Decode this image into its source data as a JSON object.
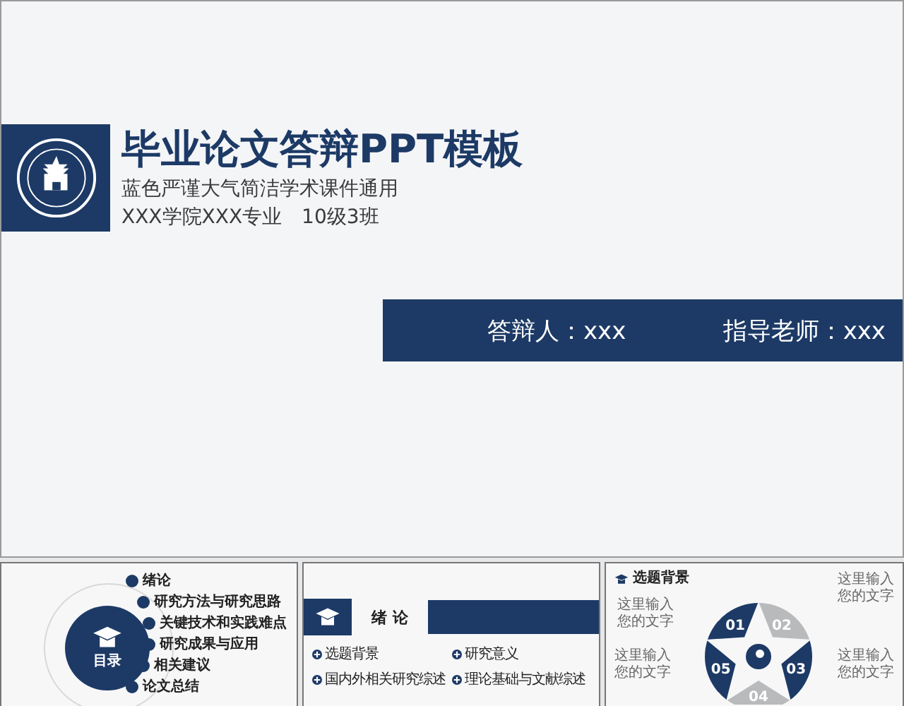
{
  "title_slide": {
    "title": "毕业论文答辩PPT模板",
    "subtitle": "蓝色严谨大气简洁学术课件通用",
    "class_info": "XXX学院XXX专业　10级3班",
    "presenter_bar": {
      "presenter": "答辩人：xxx",
      "advisor": "指导老师：xxx"
    }
  },
  "thumbnails": [
    {
      "kind": "toc",
      "badge": "目录",
      "items": [
        "绪论",
        "研究方法与研究思路",
        "关键技术和实践难点",
        "研究成果与应用",
        "相关建议",
        "论文总结"
      ]
    },
    {
      "kind": "section",
      "heading": "绪 论",
      "items": [
        "选题背景",
        "研究意义",
        "国内外相关研究综述",
        "理论基础与文献综述"
      ]
    },
    {
      "kind": "cycle",
      "heading": "选题背景",
      "steps": [
        {
          "number": "01",
          "color": "#1d3a66"
        },
        {
          "number": "02",
          "color": "#b9babc"
        },
        {
          "number": "03",
          "color": "#1d3a66"
        },
        {
          "number": "04",
          "color": "#b9babc"
        },
        {
          "number": "05",
          "color": "#1d3a66"
        }
      ],
      "captions": [
        "这里输入您的文字",
        "这里输入您的文字",
        "这里输入您的文字",
        "这里输入您的文字"
      ]
    }
  ]
}
